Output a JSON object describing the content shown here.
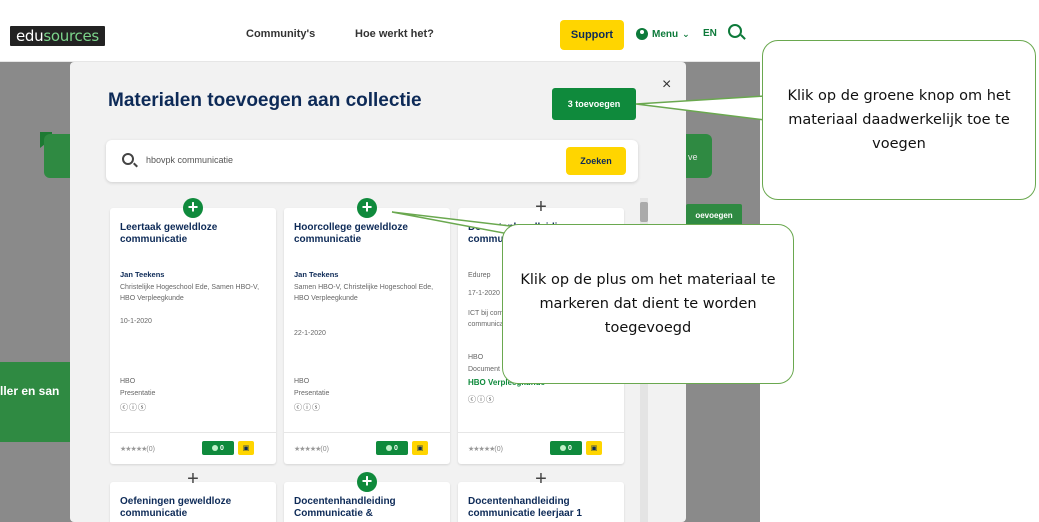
{
  "header": {
    "logo_left": "edu",
    "logo_right": "sources",
    "nav": [
      "Community's",
      "Hoe werkt het?"
    ],
    "support_label": "Support",
    "menu_label": "Menu",
    "lang": "EN"
  },
  "background": {
    "side_text": "ller en san",
    "side_button": "oevoegen",
    "side_v": "ve"
  },
  "modal": {
    "title": "Materialen toevoegen aan collectie",
    "add_button": "3 toevoegen",
    "close": "×",
    "search": {
      "value": "hbovpk communicatie",
      "button": "Zoeken"
    }
  },
  "cards": [
    {
      "title": "Leertaak geweldloze communicatie",
      "author": "Jan Teekens",
      "org": "Christelijke Hogeschool Ede, Samen HBO-V, HBO Verpleegkunde",
      "date": "10-1-2020",
      "level": "HBO",
      "type": "Presentatie",
      "rating": "(0)",
      "likes": "0",
      "selected": true
    },
    {
      "title": "Hoorcollege geweldloze communicatie",
      "author": "Jan Teekens",
      "org": "Samen HBO-V, Christelijke Hogeschool Ede, HBO Verpleegkunde",
      "date": "22-1-2020",
      "level": "HBO",
      "type": "Presentatie",
      "rating": "(0)",
      "likes": "0",
      "selected": true
    },
    {
      "title": "Docentenhandleiding communicatie",
      "author": "",
      "org": "Edurep",
      "date": "17-1-2020",
      "desc": "ICT bij communicatie, informatie en communicatie",
      "level": "HBO",
      "type": "Document",
      "tag": "HBO Verpleegkunde",
      "rating": "(0)",
      "likes": "0",
      "selected": false
    }
  ],
  "cards_row2": [
    {
      "title": "Oefeningen geweldloze communicatie",
      "selected": false
    },
    {
      "title": "Docentenhandleiding Communicatie &",
      "selected": true
    },
    {
      "title": "Docentenhandleiding communicatie leerjaar 1",
      "selected": false
    }
  ],
  "callouts": {
    "top": "Klik op de groene knop om het materiaal daadwerkelijk toe te voegen",
    "middle": "Klik op de plus om het materiaal te markeren dat dient te worden toegevoegd"
  },
  "colors": {
    "brand_green": "#0f8a3c",
    "accent_yellow": "#ffd500",
    "navy": "#0d2a57",
    "callout_border": "#6aa84f"
  }
}
